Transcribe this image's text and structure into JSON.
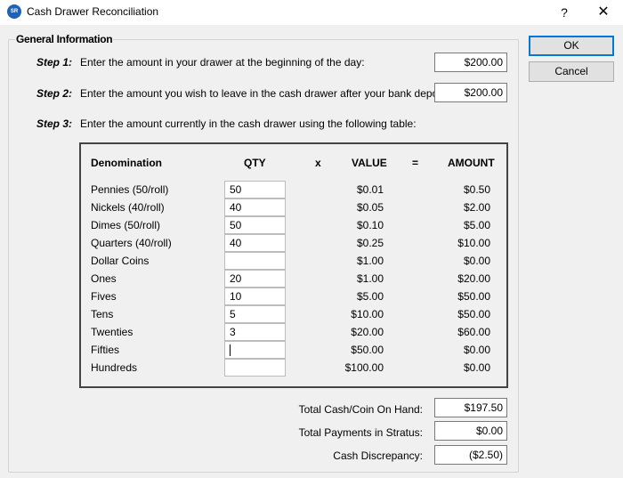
{
  "window": {
    "title": "Cash Drawer Reconciliation",
    "icon_text": "SR",
    "help_glyph": "?",
    "close_glyph": "✕"
  },
  "buttons": {
    "ok": "OK",
    "cancel": "Cancel"
  },
  "general": {
    "title": "General Information",
    "steps": [
      {
        "label": "Step 1:",
        "text": "Enter the amount in your drawer at the beginning of the day:",
        "value": "$200.00"
      },
      {
        "label": "Step 2:",
        "text": "Enter the amount you wish to leave in the cash drawer after your bank deposit:",
        "value": "$200.00"
      },
      {
        "label": "Step 3:",
        "text": "Enter the amount currently in the cash drawer using the following table:"
      }
    ]
  },
  "table": {
    "headers": {
      "denomination": "Denomination",
      "qty": "QTY",
      "x": "x",
      "value": "VALUE",
      "eq": "=",
      "amount": "AMOUNT"
    },
    "rows": [
      {
        "name": "Pennies (50/roll)",
        "qty": "50",
        "value": "$0.01",
        "amount": "$0.50"
      },
      {
        "name": "Nickels (40/roll)",
        "qty": "40",
        "value": "$0.05",
        "amount": "$2.00"
      },
      {
        "name": "Dimes (50/roll)",
        "qty": "50",
        "value": "$0.10",
        "amount": "$5.00"
      },
      {
        "name": "Quarters (40/roll)",
        "qty": "40",
        "value": "$0.25",
        "amount": "$10.00"
      },
      {
        "name": "Dollar Coins",
        "qty": "",
        "value": "$1.00",
        "amount": "$0.00"
      },
      {
        "name": "Ones",
        "qty": "20",
        "value": "$1.00",
        "amount": "$20.00"
      },
      {
        "name": "Fives",
        "qty": "10",
        "value": "$5.00",
        "amount": "$50.00"
      },
      {
        "name": "Tens",
        "qty": "5",
        "value": "$10.00",
        "amount": "$50.00"
      },
      {
        "name": "Twenties",
        "qty": "3",
        "value": "$20.00",
        "amount": "$60.00"
      },
      {
        "name": "Fifties",
        "qty": "",
        "value": "$50.00",
        "amount": "$0.00"
      },
      {
        "name": "Hundreds",
        "qty": "",
        "value": "$100.00",
        "amount": "$0.00"
      }
    ]
  },
  "totals": [
    {
      "label": "Total Cash/Coin On Hand:",
      "value": "$197.50"
    },
    {
      "label": "Total Payments in Stratus:",
      "value": "$0.00"
    },
    {
      "label": "Cash Discrepancy:",
      "value": "($2.50)"
    }
  ]
}
